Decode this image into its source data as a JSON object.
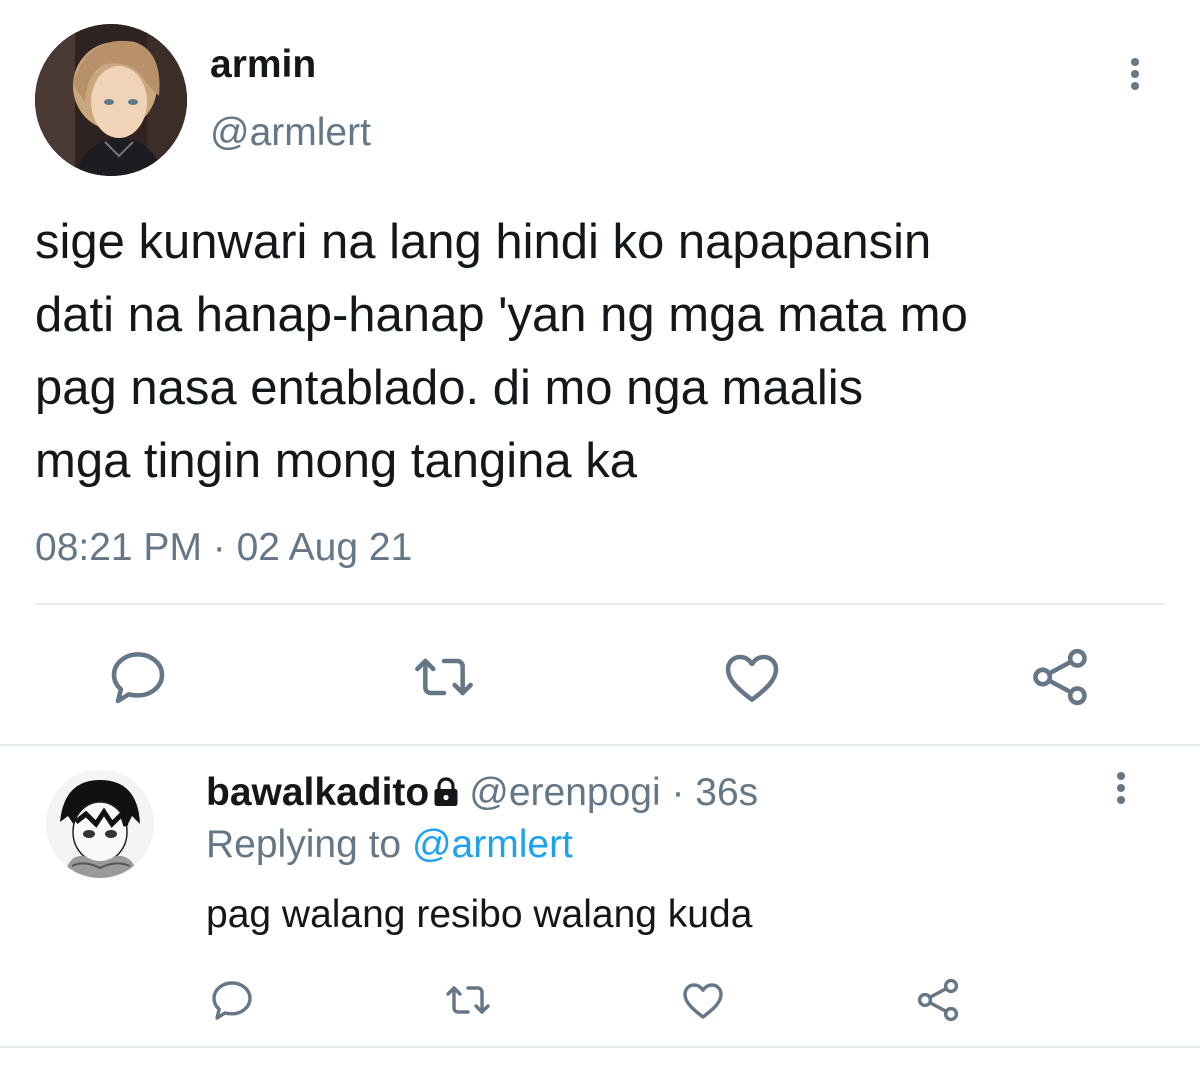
{
  "main_tweet": {
    "display_name": "armin",
    "handle": "@armlert",
    "lines": [
      "sige kunwari na lang hindi ko napapansin",
      "dati na hanap-hanap 'yan ng mga mata mo",
      "pag nasa entablado. di mo nga maalis",
      "mga tingin mong tangina ka"
    ],
    "time": "08:21 PM",
    "separator": " · ",
    "date": "02 Aug 21",
    "icons": [
      "reply-icon",
      "retweet-icon",
      "like-icon",
      "share-icon"
    ]
  },
  "reply": {
    "display_name": "bawalkadito",
    "handle": "@erenpogi",
    "separator": " · ",
    "time": "36s",
    "replying_prefix": "Replying to ",
    "replying_to": "@armlert",
    "text": "pag walang resibo walang kuda",
    "icons": [
      "reply-icon",
      "retweet-icon",
      "like-icon",
      "share-icon"
    ]
  },
  "colors": {
    "text": "#14171a",
    "secondary": "#657786",
    "link": "#1da1f2",
    "divider": "#e6ecf0"
  }
}
